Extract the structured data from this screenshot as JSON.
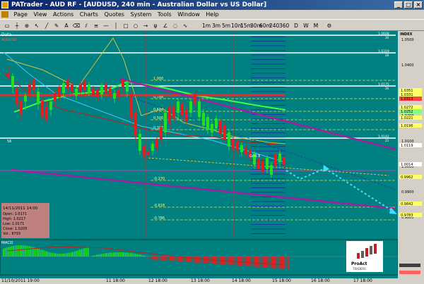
{
  "window": {
    "title": "PATrader - AUD RF - [AUDUSD, 240 min - Australian Dollar vs US Dollar]"
  },
  "menu": [
    "Page",
    "View",
    "Actions",
    "Charts",
    "Quotes",
    "System",
    "Tools",
    "Window",
    "Help"
  ],
  "toolbar": {
    "timeframes": [
      "1m",
      "3m",
      "5m",
      "10m",
      "15m",
      "30m",
      "60m",
      "240",
      "360",
      "D",
      "W",
      "M"
    ]
  },
  "chart": {
    "data_label": "Data",
    "index_label": "INDEX",
    "symbol_label": "AUDUSD",
    "macd_label": "MACD",
    "info_box": {
      "date": "14/11/2011 14:00",
      "open": "Open: 1.0171",
      "high": "High: 1.0217",
      "low": "Low: 1.0171",
      "close": "Close: 1.0205",
      "vol": "Vol.: 8793"
    },
    "fib_levels": [
      "1.000",
      "0.786",
      "0.618",
      "0.500",
      "0.382",
      "-0.270",
      "-0.618",
      "-0.786"
    ],
    "price_axis": [
      "1.0500",
      "1.0400",
      "1.0300",
      "1.0200",
      "1.0100",
      "1.0000",
      "0.9900",
      "0.9800"
    ],
    "price_tags": [
      {
        "label": "1.0351",
        "color": "#ffff66"
      },
      {
        "label": "1.0331",
        "color": "#ffff66"
      },
      {
        "label": "1.0313",
        "color": "#ff4040"
      },
      {
        "label": "1.0272",
        "color": "#ffff66"
      },
      {
        "label": "1.0252",
        "color": "#80ff80"
      },
      {
        "label": "1.0221",
        "color": "#ffff66"
      },
      {
        "label": "1.0196",
        "color": "#ffff66"
      },
      {
        "label": "1.0119",
        "color": "#ffffff"
      },
      {
        "label": "1.0014",
        "color": "#ffffff"
      },
      {
        "label": "0.9962",
        "color": "#ffff66"
      },
      {
        "label": "0.9842",
        "color": "#ffff66"
      },
      {
        "label": "0.9783",
        "color": "#ffff66"
      }
    ],
    "level_tags": [
      {
        "label": "1.0608",
        "sub": "30"
      },
      {
        "label": "1.0319",
        "sub": "28"
      },
      {
        "label": "1.0175",
        "sub": "26"
      },
      {
        "label": "1.0142",
        "sub": "25"
      }
    ],
    "grid_label": "Grid 8",
    "left_marker": "56",
    "logo": {
      "line1": "ProAct",
      "line2": "TRADERS"
    }
  },
  "time_axis": [
    "11/10/2011 19:00",
    "11 18:00",
    "12 18:00",
    "13 18:00",
    "14 18:00",
    "15 18:00",
    "16 18:00",
    "17 18:00"
  ]
}
